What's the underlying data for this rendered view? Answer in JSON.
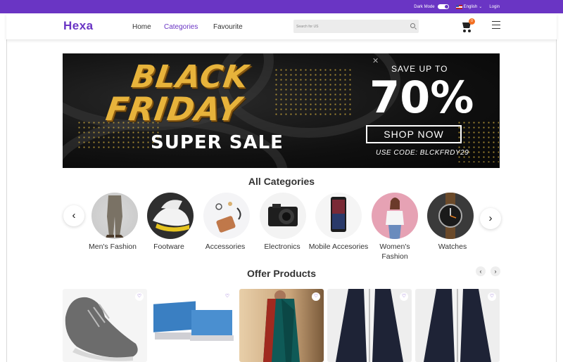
{
  "topbar": {
    "dark_mode_label": "Dark Mode",
    "language": "English",
    "login": "Login"
  },
  "header": {
    "logo": "Hexa",
    "nav": [
      "Home",
      "Categories",
      "Favourite"
    ],
    "search_placeholder": "Search for US",
    "cart_count": "0"
  },
  "banner": {
    "line1": "BLACK",
    "line2": "FRIDAY",
    "line3": "SUPER SALE",
    "save_up": "SAVE UP TO",
    "percent": "70%",
    "cta": "SHOP NOW",
    "code": "USE CODE: BLCKFRDY29"
  },
  "categories": {
    "title": "All Categories",
    "items": [
      {
        "label": "Men's Fashion"
      },
      {
        "label": "Footware"
      },
      {
        "label": "Accessories"
      },
      {
        "label": "Electronics"
      },
      {
        "label": "Mobile Accesories"
      },
      {
        "label": "Women's Fashion"
      },
      {
        "label": "Watches"
      }
    ]
  },
  "offers": {
    "title": "Offer Products",
    "products": [
      {
        "image": "grey running sneaker"
      },
      {
        "image": "laptops"
      },
      {
        "image": "green saree"
      },
      {
        "image": "navy bomber jacket"
      },
      {
        "image": "navy bomber jacket"
      }
    ]
  },
  "colors": {
    "brand": "#6a35c4",
    "badge": "#f36f21",
    "banner_gold": "#e7b33b"
  },
  "icons": [
    "search-icon",
    "cart-icon",
    "menu-icon",
    "heart-icon",
    "chevron-left-icon",
    "chevron-right-icon",
    "close-icon"
  ]
}
